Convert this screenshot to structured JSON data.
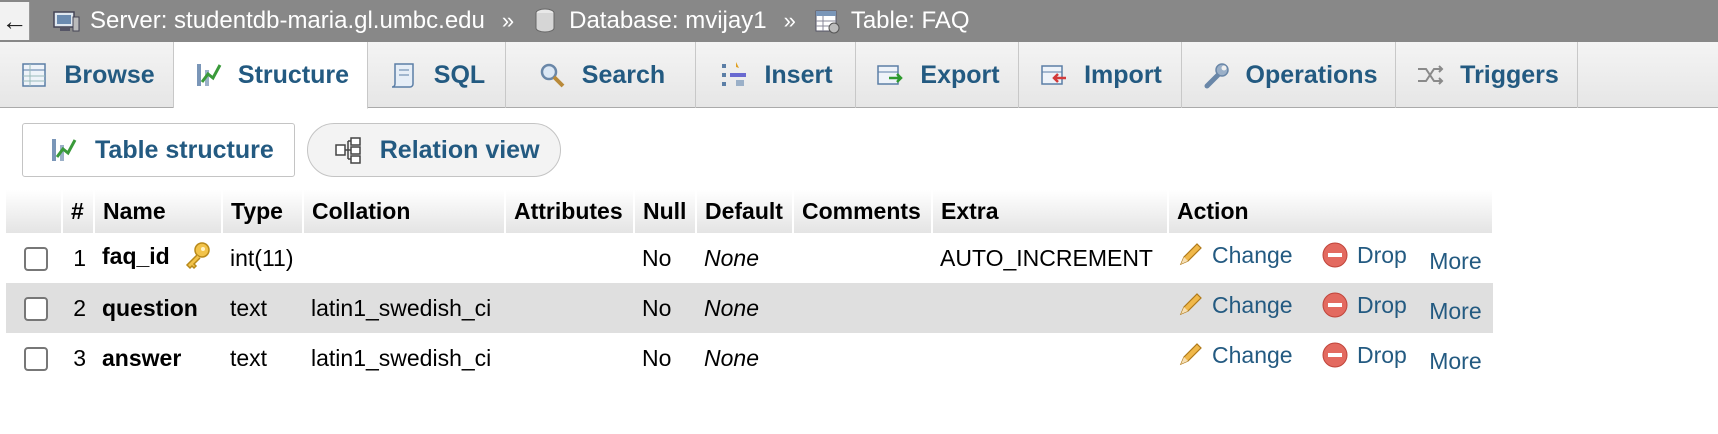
{
  "breadcrumb": {
    "back_glyph": "←",
    "server": "Server: studentdb-maria.gl.umbc.edu",
    "database": "Database: mvijay1",
    "table": "Table: FAQ",
    "separator": "»"
  },
  "tabs": [
    {
      "label": "Browse",
      "icon": "browse-icon"
    },
    {
      "label": "Structure",
      "icon": "structure-icon",
      "active": true
    },
    {
      "label": "SQL",
      "icon": "sql-icon"
    },
    {
      "label": "Search",
      "icon": "search-icon"
    },
    {
      "label": "Insert",
      "icon": "insert-icon"
    },
    {
      "label": "Export",
      "icon": "export-icon"
    },
    {
      "label": "Import",
      "icon": "import-icon"
    },
    {
      "label": "Operations",
      "icon": "wrench-icon"
    },
    {
      "label": "Triggers",
      "icon": "triggers-icon"
    }
  ],
  "subtabs": {
    "table_structure": "Table structure",
    "relation_view": "Relation view"
  },
  "table": {
    "headers": [
      "#",
      "Name",
      "Type",
      "Collation",
      "Attributes",
      "Null",
      "Default",
      "Comments",
      "Extra",
      "Action"
    ],
    "rows": [
      {
        "num": "1",
        "name": "faq_id",
        "primary_key": true,
        "type": "int(11)",
        "collation": "",
        "attributes": "",
        "null": "No",
        "default": "None",
        "comments": "",
        "extra": "AUTO_INCREMENT"
      },
      {
        "num": "2",
        "name": "question",
        "primary_key": false,
        "type": "text",
        "collation": "latin1_swedish_ci",
        "attributes": "",
        "null": "No",
        "default": "None",
        "comments": "",
        "extra": ""
      },
      {
        "num": "3",
        "name": "answer",
        "primary_key": false,
        "type": "text",
        "collation": "latin1_swedish_ci",
        "attributes": "",
        "null": "No",
        "default": "None",
        "comments": "",
        "extra": ""
      }
    ],
    "actions": {
      "change": "Change",
      "drop": "Drop",
      "more": "More"
    }
  },
  "colors": {
    "topbar": "#888888",
    "link": "#235a81",
    "row_alt": "#dfdfdf",
    "drop_red": "#d9534f"
  }
}
